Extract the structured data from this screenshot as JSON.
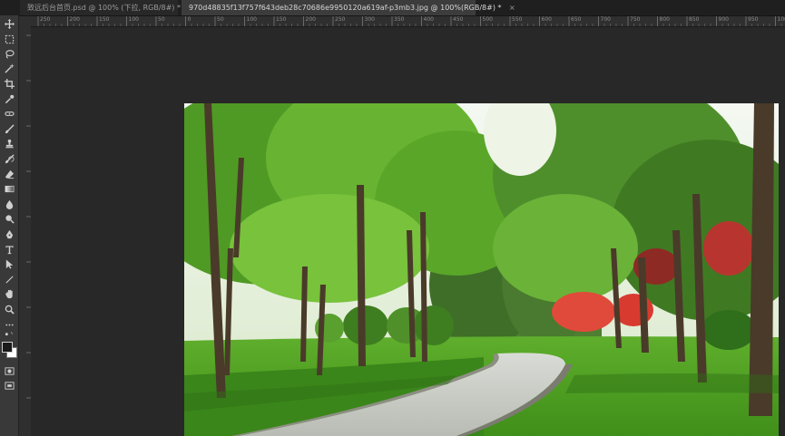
{
  "tabs": [
    {
      "title": "致远后台首页.psd @ 100% (下拉, RGB/8#) *",
      "close": "×",
      "active": false
    },
    {
      "title": "970d48835f13f757f643deb28c70686e9950120a619af-p3mb3.jpg @ 100%(RGB/8#) *",
      "close": "×",
      "active": true
    }
  ],
  "ruler_labels": [
    "250",
    "200",
    "150",
    "100",
    "50",
    "0",
    "50",
    "100",
    "150",
    "200",
    "250",
    "300",
    "350",
    "400",
    "450",
    "500",
    "550",
    "600",
    "650",
    "700",
    "750",
    "800",
    "850",
    "900",
    "950",
    "1000"
  ],
  "tools": [
    {
      "icon": "move-icon"
    },
    {
      "icon": "marquee-icon"
    },
    {
      "icon": "lasso-icon"
    },
    {
      "icon": "magic-wand-icon"
    },
    {
      "icon": "crop-icon"
    },
    {
      "icon": "eyedropper-icon"
    },
    {
      "icon": "healing-brush-icon"
    },
    {
      "icon": "brush-icon"
    },
    {
      "icon": "clone-stamp-icon"
    },
    {
      "icon": "history-brush-icon"
    },
    {
      "icon": "eraser-icon"
    },
    {
      "icon": "gradient-icon"
    },
    {
      "icon": "blur-icon"
    },
    {
      "icon": "dodge-icon"
    },
    {
      "icon": "pen-icon"
    },
    {
      "icon": "type-icon"
    },
    {
      "icon": "path-selection-icon"
    },
    {
      "icon": "line-icon"
    },
    {
      "icon": "hand-icon"
    },
    {
      "icon": "zoom-icon"
    },
    {
      "icon": "more-tools-icon"
    }
  ],
  "colors": {
    "foreground": "#1a1a1a",
    "background": "#ffffff",
    "accent_red": "#e04a3a"
  }
}
